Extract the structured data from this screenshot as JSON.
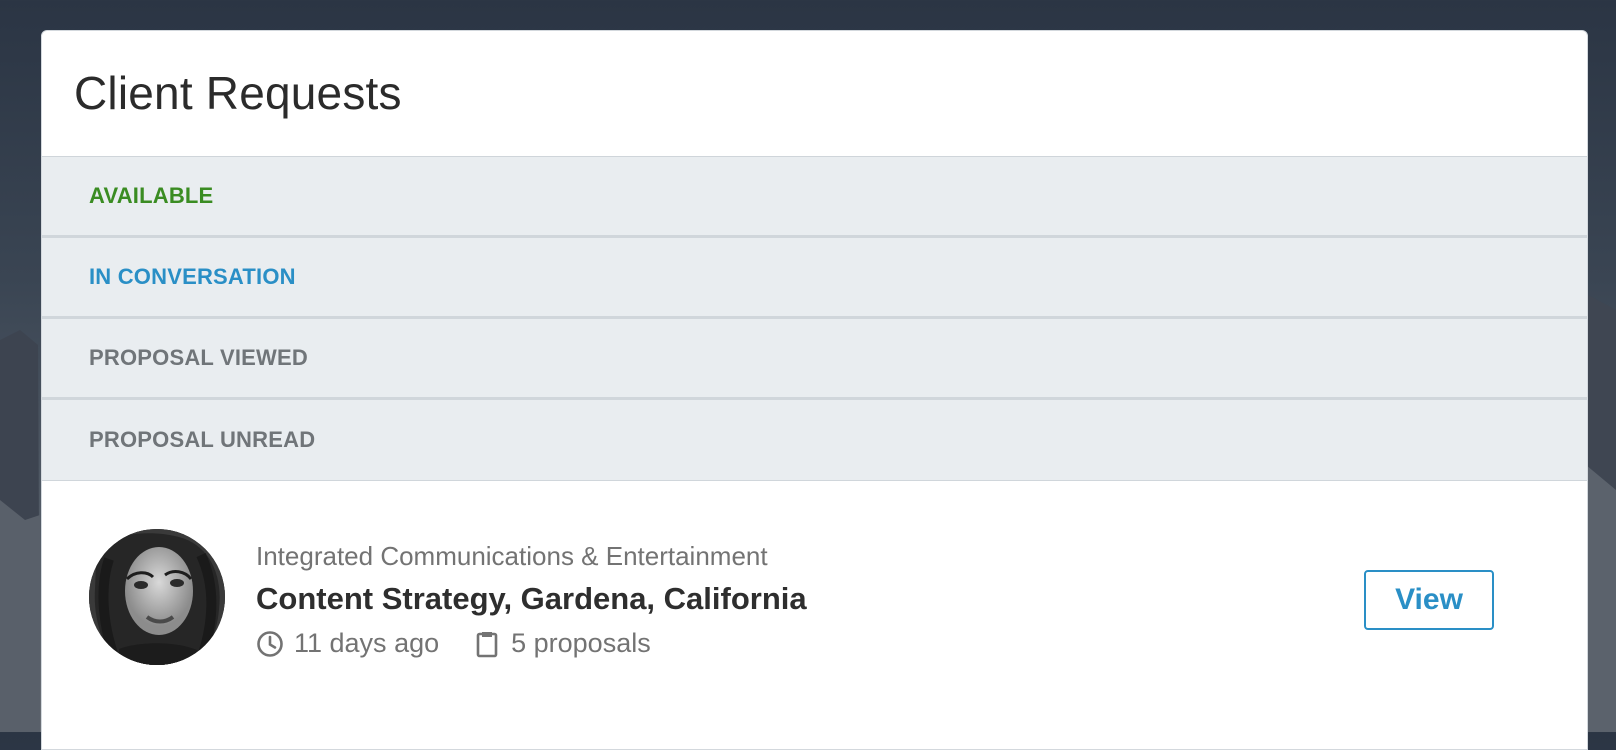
{
  "page": {
    "title": "Client Requests"
  },
  "status_tabs": [
    {
      "label": "AVAILABLE",
      "color": "#3a8c22"
    },
    {
      "label": "IN CONVERSATION",
      "color": "#2a8fc6"
    },
    {
      "label": "PROPOSAL VIEWED",
      "color": "#707579"
    },
    {
      "label": "PROPOSAL UNREAD",
      "color": "#707579"
    }
  ],
  "request": {
    "company": "Integrated Communications & Entertainment",
    "title": "Content Strategy, Gardena, California",
    "posted": "11 days ago",
    "proposals": "5 proposals",
    "view_label": "View",
    "icons": {
      "time": "clock-icon",
      "proposals": "clipboard-icon"
    }
  },
  "colors": {
    "accent": "#2a8fc6",
    "available": "#3a8c22",
    "muted": "#707579",
    "status_bg": "#e9edf0"
  }
}
